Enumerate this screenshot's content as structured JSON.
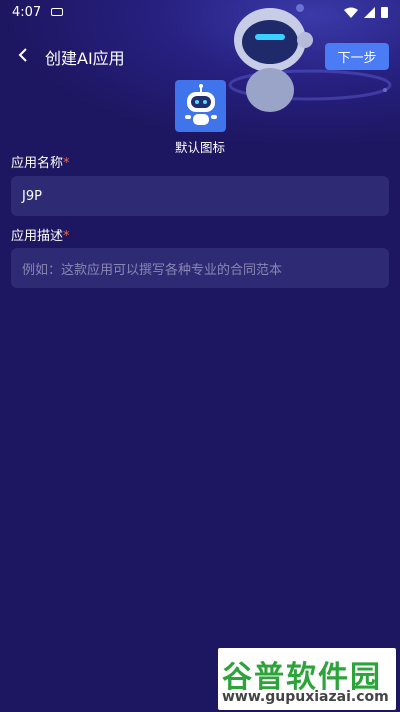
{
  "status_bar": {
    "time": "4:07"
  },
  "header": {
    "title": "创建AI应用",
    "next_label": "下一步"
  },
  "icon_section": {
    "label": "默认图标"
  },
  "form": {
    "name_label": "应用名称",
    "name_value": "J9P",
    "desc_label": "应用描述",
    "desc_placeholder": "例如：这款应用可以撰写各种专业的合同范本",
    "required_mark": "*"
  },
  "watermark": {
    "title": "谷普软件园",
    "url": "www.gupuxiazai.com"
  },
  "colors": {
    "background": "#1d1660",
    "accent": "#4b7cf5",
    "input_bg": "#2e2a73",
    "required": "#e86a4a"
  }
}
